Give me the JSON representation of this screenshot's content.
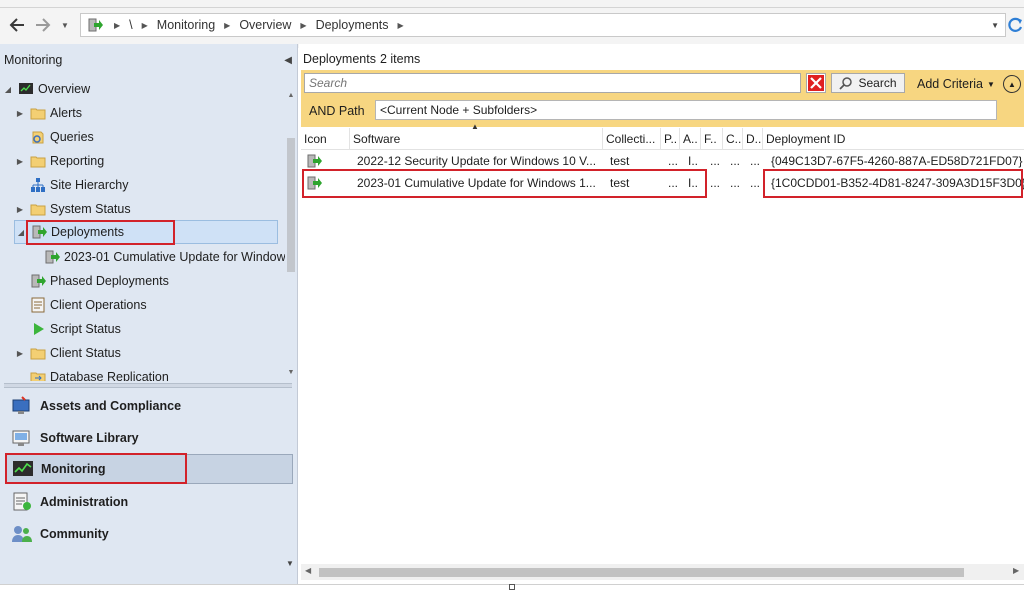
{
  "address": {
    "root": "\\",
    "crumbs": [
      "Monitoring",
      "Overview",
      "Deployments"
    ]
  },
  "left_pane": {
    "header": "Monitoring",
    "tree": [
      {
        "label": "Overview",
        "icon": "overview-icon"
      },
      {
        "label": "Alerts",
        "icon": "folder-icon"
      },
      {
        "label": "Queries",
        "icon": "queries-icon"
      },
      {
        "label": "Reporting",
        "icon": "folder-icon"
      },
      {
        "label": "Site Hierarchy",
        "icon": "site-hierarchy-icon"
      },
      {
        "label": "System Status",
        "icon": "folder-icon"
      },
      {
        "label": "Deployments",
        "icon": "deployment-icon"
      },
      {
        "label": "2023-01 Cumulative Update for Windows",
        "icon": "deployment-icon"
      },
      {
        "label": "Phased Deployments",
        "icon": "phased-deployment-icon"
      },
      {
        "label": "Client Operations",
        "icon": "client-operations-icon"
      },
      {
        "label": "Script Status",
        "icon": "script-status-icon"
      },
      {
        "label": "Client Status",
        "icon": "folder-icon"
      },
      {
        "label": "Database Replication",
        "icon": "database-replication-icon"
      }
    ],
    "workspaces": [
      {
        "label": "Assets and Compliance",
        "icon": "assets-compliance-icon"
      },
      {
        "label": "Software Library",
        "icon": "software-library-icon"
      },
      {
        "label": "Monitoring",
        "icon": "monitoring-icon"
      },
      {
        "label": "Administration",
        "icon": "administration-icon"
      },
      {
        "label": "Community",
        "icon": "community-icon"
      }
    ]
  },
  "content": {
    "title": "Deployments",
    "count": "2 items",
    "search": {
      "placeholder": "Search",
      "button": "Search",
      "add_criteria": "Add Criteria"
    },
    "criteria": {
      "label": "AND Path",
      "value": "<Current Node + Subfolders>"
    },
    "columns": [
      "Icon",
      "Software",
      "Collecti...",
      "P..",
      "A..",
      "F..",
      "C..",
      "D..",
      "Deployment ID"
    ],
    "rows": [
      {
        "software": "2022-12 Security Update for Windows 10 V...",
        "collection": "test",
        "p": "...",
        "a": "I..",
        "f": "...",
        "c": "...",
        "d": "...",
        "deployment_id": "{049C13D7-67F5-4260-887A-ED58D721FD07}"
      },
      {
        "software": "2023-01 Cumulative Update for Windows 1...",
        "collection": "test",
        "p": "...",
        "a": "I..",
        "f": "...",
        "c": "...",
        "d": "...",
        "deployment_id": "{1C0CDD01-B352-4D81-8247-309A3D15F3D0}"
      }
    ]
  },
  "colors": {
    "highlight": "#d2222a",
    "search_bar": "#f7d681",
    "nav_background": "#dfe7f2"
  }
}
